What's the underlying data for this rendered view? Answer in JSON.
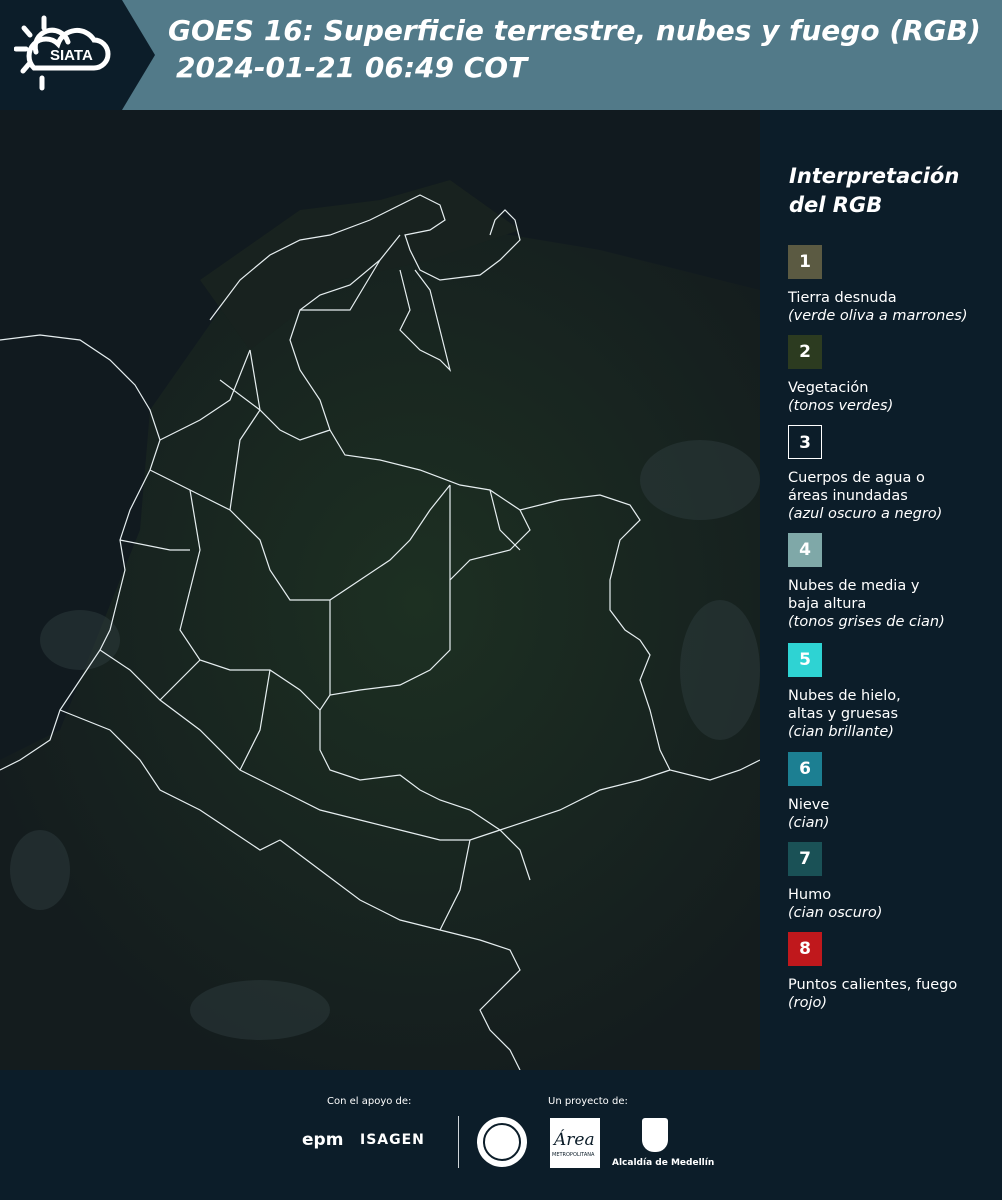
{
  "header": {
    "brand": "SIATA",
    "title_line1": "GOES 16: Superficie terrestre, nubes y fuego (RGB)",
    "title_line2": "2024-01-21 06:49 COT"
  },
  "legend": {
    "title_line1": "Interpretación",
    "title_line2": "del RGB",
    "items": [
      {
        "number": "1",
        "label": "Tierra desnuda",
        "desc": "(verde oliva a marrones)",
        "color": "#5b5a42"
      },
      {
        "number": "2",
        "label": "Vegetación",
        "desc": "(tonos verdes)",
        "color": "#2c3b20"
      },
      {
        "number": "3",
        "label": "Cuerpos de agua o\náreas inundadas",
        "desc": "(azul oscuro a negro)",
        "color": "#0c1d29"
      },
      {
        "number": "4",
        "label": "Nubes de media y\nbaja altura",
        "desc": "(tonos grises de cian)",
        "color": "#7fa8a8"
      },
      {
        "number": "5",
        "label": "Nubes de hielo,\naltas y gruesas",
        "desc": "(cian brillante)",
        "color": "#2ed3d3"
      },
      {
        "number": "6",
        "label": "Nieve",
        "desc": "(cian)",
        "color": "#1c7f92"
      },
      {
        "number": "7",
        "label": "Humo",
        "desc": "(cian oscuro)",
        "color": "#1a5156"
      },
      {
        "number": "8",
        "label": "Puntos calientes, fuego",
        "desc": "(rojo)",
        "color": "#c0181c"
      }
    ]
  },
  "footer": {
    "support_label": "Con el apoyo de:",
    "project_label": "Un proyecto de:",
    "sponsor_epm": "epm",
    "sponsor_isagen": "ISAGEN",
    "partner_area": "Área",
    "partner_area_sub": "METROPOLITANA",
    "partner_alcaldia": "Alcaldía de Medellín"
  }
}
